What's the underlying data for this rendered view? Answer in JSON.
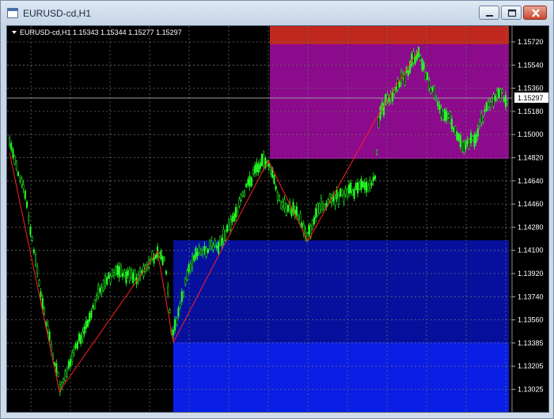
{
  "window": {
    "title": "EURUSD-cd,H1"
  },
  "chart": {
    "header": "EURUSD-cd,H1  1.15343 1.15344 1.15277 1.15297",
    "current_price_label": "1.15297",
    "price_labels": [
      "1.15720",
      "1.15540",
      "1.15360",
      "1.15180",
      "1.15000",
      "1.14820",
      "1.14640",
      "1.14460",
      "1.14280",
      "1.14100",
      "1.13920",
      "1.13740",
      "1.13560",
      "1.13385",
      "1.13205",
      "1.13025"
    ],
    "colors": {
      "background": "#000000",
      "candle_up": "#22ff22",
      "zigzag": "#ff2020",
      "zone_red": "#c0281e",
      "zone_magenta": "#8c0a8c",
      "zone_dark_blue": "#06109c",
      "zone_blue": "#0a1ee6"
    }
  },
  "icons": {
    "app": "window-icon",
    "minimize": "minimize-icon",
    "maximize": "maximize-icon",
    "close": "close-icon",
    "dropdown": "triangle-down-icon"
  }
}
